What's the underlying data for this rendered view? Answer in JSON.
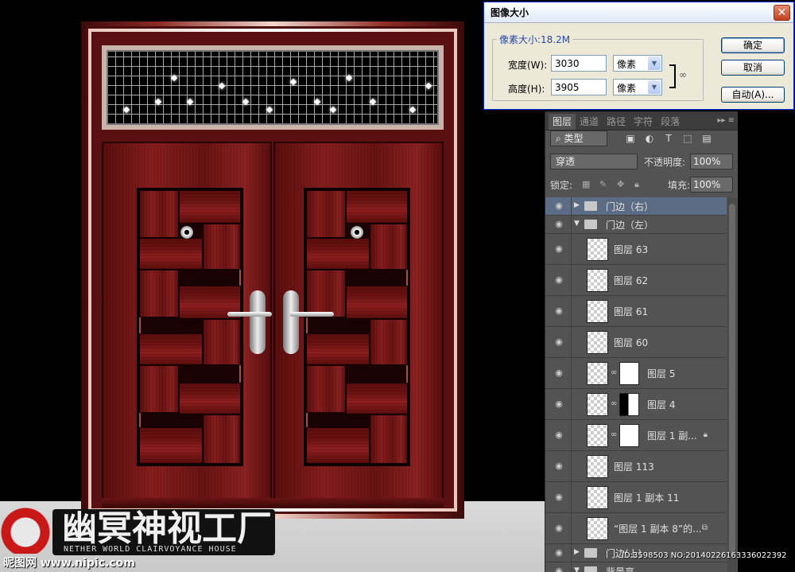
{
  "dialog": {
    "title": "图像大小",
    "close_glyph": "✕",
    "pixel_size_label": "像素大小:18.2M",
    "width_label": "宽度(W):",
    "width_value": "3030",
    "height_label": "高度(H):",
    "height_value": "3905",
    "unit_width": "像素",
    "unit_height": "像素",
    "ok_label": "确定",
    "cancel_label": "取消",
    "auto_label": "自动(A)..."
  },
  "layers_panel": {
    "tabs": [
      "图层",
      "通道",
      "路径",
      "字符",
      "段落"
    ],
    "active_tab": 0,
    "kind_filter": "类型",
    "blend_mode": "穿透",
    "opacity_label": "不透明度:",
    "opacity_value": "100%",
    "lock_label": "锁定:",
    "fill_label": "填充:",
    "fill_value": "100%",
    "layers": [
      {
        "type": "group",
        "name": "门边（右）",
        "expanded": false,
        "selected": true
      },
      {
        "type": "group",
        "name": "门边（左）",
        "expanded": true,
        "selected": false
      },
      {
        "type": "layer",
        "name": "图层 63"
      },
      {
        "type": "layer",
        "name": "图层 62"
      },
      {
        "type": "layer",
        "name": "图层 61"
      },
      {
        "type": "layer",
        "name": "图层 60"
      },
      {
        "type": "masked",
        "name": "图层 5",
        "mask": "white"
      },
      {
        "type": "masked",
        "name": "图层 4",
        "mask": "black"
      },
      {
        "type": "masked",
        "name": "图层 1 副...",
        "mask": "white",
        "badge": "lock"
      },
      {
        "type": "layer",
        "name": "图层 113"
      },
      {
        "type": "layer",
        "name": "图层 1 副本 11"
      },
      {
        "type": "layer",
        "name": "“图层 1 副本 8”的...",
        "badge": "smart"
      },
      {
        "type": "group",
        "name": "门边(上)",
        "expanded": false,
        "selected": false
      },
      {
        "type": "group",
        "name": "背景亮",
        "expanded": true,
        "selected": false
      }
    ]
  },
  "watermark": {
    "title": "幽冥神视工厂",
    "subtitle": "NETHER WORLD CLAIRVOYANCE HOUSE",
    "site": "昵图网 www.nipic.com",
    "id_text": "ID:3598503 NO:20140226163336022392"
  }
}
